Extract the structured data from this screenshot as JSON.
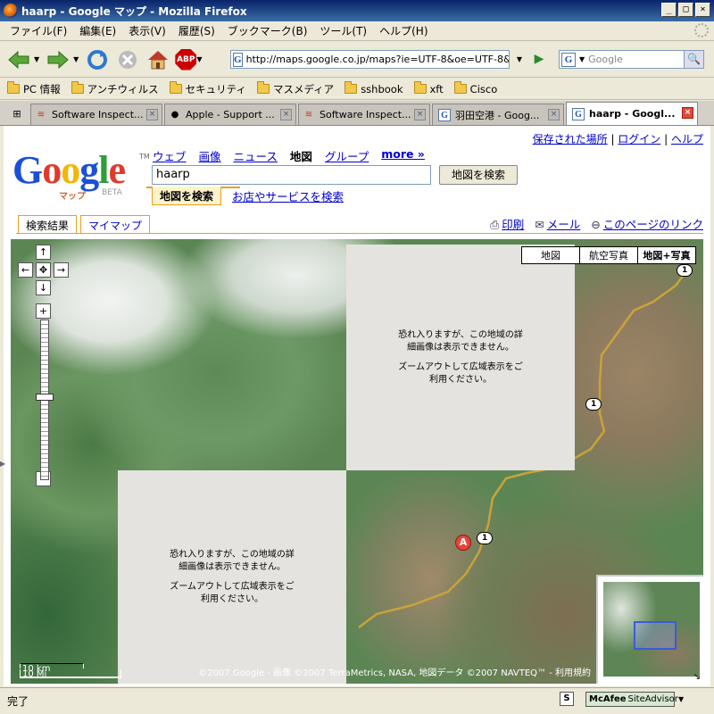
{
  "window": {
    "title": "haarp - Google マップ - Mozilla Firefox",
    "min": "_",
    "max": "□",
    "close": "×"
  },
  "menu": [
    "ファイル(F)",
    "編集(E)",
    "表示(V)",
    "履歴(S)",
    "ブックマーク(B)",
    "ツール(T)",
    "ヘルプ(H)"
  ],
  "toolbar": {
    "url": "http://maps.google.co.jp/maps?ie=UTF-8&oe=UTF-8&hl=",
    "search_placeholder": "Google",
    "abp": "ABP"
  },
  "bookmarks": [
    "PC 情報",
    "アンチウィルス",
    "セキュリティ",
    "マスメディア",
    "sshbook",
    "xft",
    "Cisco"
  ],
  "tabs": [
    {
      "label": "Software Inspect...",
      "icon": "secunia"
    },
    {
      "label": "Apple - Support ...",
      "icon": "apple"
    },
    {
      "label": "Software Inspect...",
      "icon": "secunia"
    },
    {
      "label": "羽田空港 - Goog...",
      "icon": "google"
    },
    {
      "label": "haarp - Googl...",
      "icon": "google",
      "active": true
    }
  ],
  "page": {
    "toplinks": {
      "saved": "保存された場所",
      "sep1": " | ",
      "login": "ログイン",
      "sep2": " | ",
      "help": "ヘルプ"
    },
    "logo": {
      "text": "Google",
      "sub": "マップ",
      "beta": "BETA",
      "tm": "TM"
    },
    "nav": {
      "web": "ウェブ",
      "images": "画像",
      "news": "ニュース",
      "maps": "地図",
      "groups": "グループ",
      "more": "more »"
    },
    "query": "haarp",
    "search_button": "地図を検索",
    "search_tab_maps": "地図を検索",
    "search_tab_business": "お店やサービスを検索",
    "panel_tabs": {
      "results": "検索結果",
      "mymaps": "マイマップ"
    },
    "tools": {
      "print": "印刷",
      "mail": "メール",
      "link": "このページのリンク"
    }
  },
  "map": {
    "types": {
      "map": "地図",
      "satellite": "航空写真",
      "hybrid": "地図+写真"
    },
    "tile_msg_1": "恐れ入りますが、この地域の詳細画像は表示できません。",
    "tile_msg_2": "ズームアウトして広域表示をご利用ください。",
    "scale_km": "10 km",
    "scale_mi": "10 Mi",
    "copyright": "©2007 Google - 画像 ©2007 TerraMetrics, NASA, 地図データ ©2007 NAVTEQ™ - 利用規約",
    "marker": "A",
    "route_shield": "1",
    "pan_up": "↑",
    "pan_down": "↓",
    "pan_left": "←",
    "pan_right": "→",
    "pan_center": "✥",
    "zoom_in": "+",
    "zoom_out": "−"
  },
  "status": {
    "text": "完了",
    "s_icon": "S",
    "mcafee": "McAfee",
    "siteadvisor": "SiteAdvisor"
  }
}
